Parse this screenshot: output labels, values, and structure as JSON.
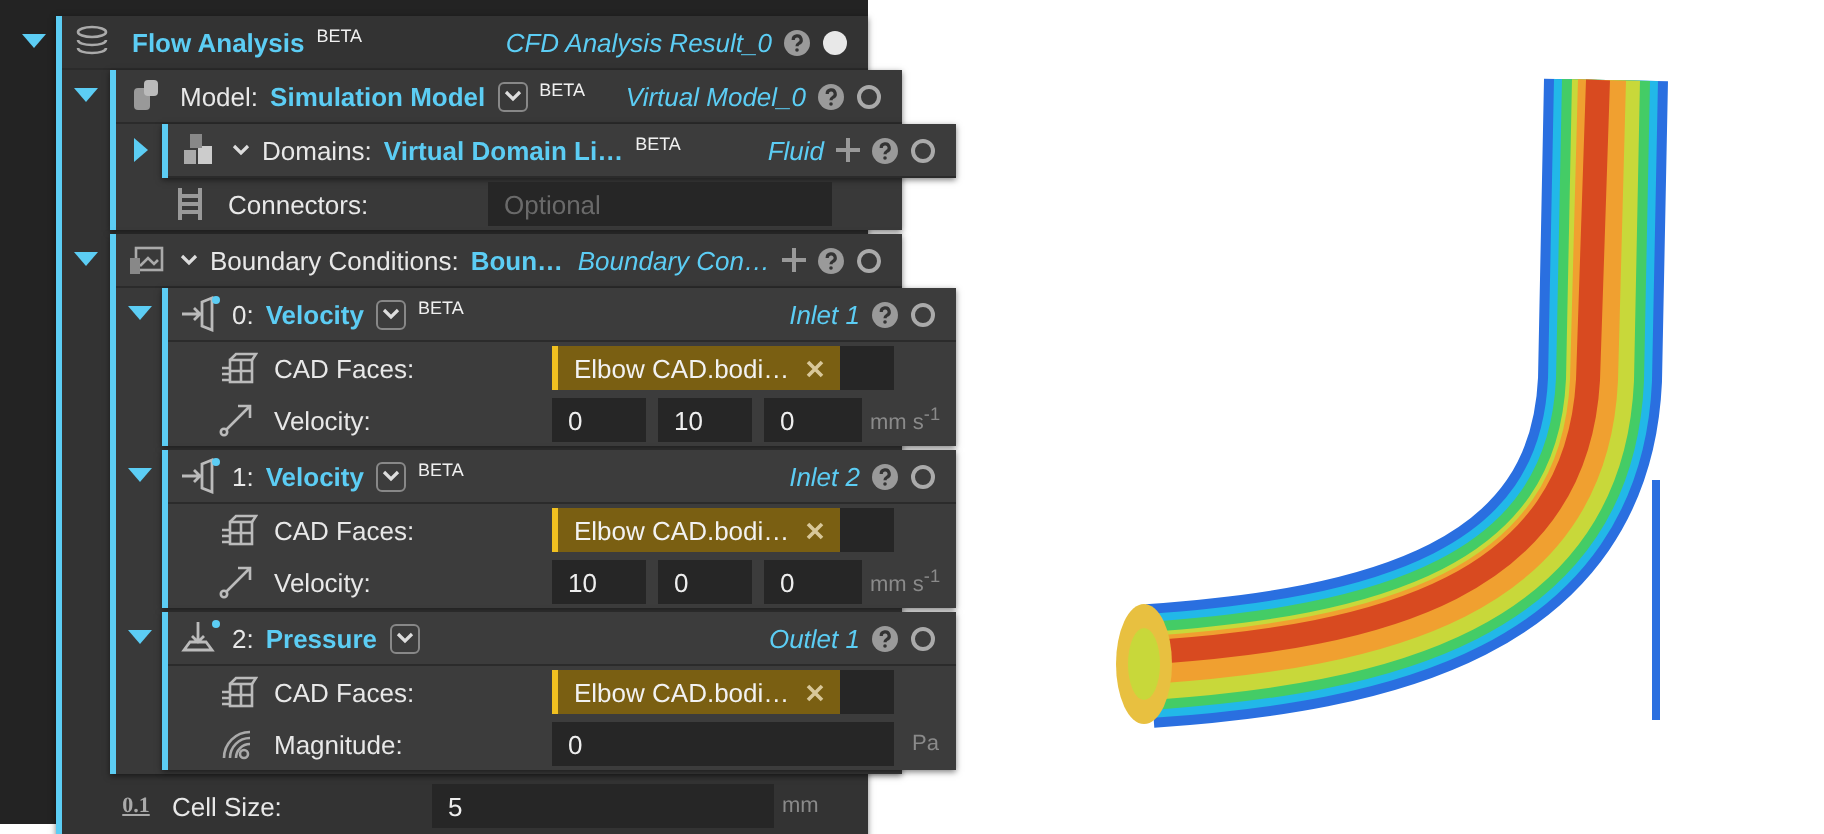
{
  "analysis": {
    "expanded": true,
    "title": "Flow Analysis",
    "badge": "BETA",
    "result": "CFD Analysis Result_0",
    "active": true,
    "model": {
      "expanded": true,
      "label": "Model:",
      "value": "Simulation Model",
      "dropdown": true,
      "badge": "BETA",
      "result": "Virtual Model_0",
      "active": false,
      "domains": {
        "expanded": false,
        "chevron": true,
        "label": "Domains:",
        "value": "Virtual Domain Li…",
        "badge": "BETA",
        "result": "Fluid",
        "add": true,
        "active": false
      },
      "connectors": {
        "label": "Connectors:",
        "placeholder": "Optional"
      }
    },
    "boundary_conditions": {
      "expanded": true,
      "chevron": true,
      "label": "Boundary Conditions:",
      "value": "Boun…",
      "result": "Boundary Con…",
      "add": true,
      "active": false,
      "conditions": [
        {
          "expanded": true,
          "kind": "inlet",
          "modified": true,
          "label": "0:",
          "value": "Velocity",
          "dropdown": true,
          "badge": "BETA",
          "result": "Inlet 1",
          "active": false,
          "fields": [
            {
              "kind": "faces",
              "label": "CAD Faces:",
              "value": "Elbow CAD.bodi…"
            },
            {
              "kind": "vector",
              "label": "Velocity:",
              "values": [
                "0",
                "10",
                "0"
              ],
              "unit": "mm s$^{-1}$"
            }
          ]
        },
        {
          "expanded": true,
          "kind": "inlet",
          "modified": true,
          "label": "1:",
          "value": "Velocity",
          "dropdown": true,
          "badge": "BETA",
          "result": "Inlet 2",
          "active": false,
          "fields": [
            {
              "kind": "faces",
              "label": "CAD Faces:",
              "value": "Elbow CAD.bodi…"
            },
            {
              "kind": "vector",
              "label": "Velocity:",
              "values": [
                "10",
                "0",
                "0"
              ],
              "unit": "mm s$^{-1}$"
            }
          ]
        },
        {
          "expanded": true,
          "kind": "outlet",
          "modified": true,
          "label": "2:",
          "value": "Pressure",
          "dropdown": true,
          "result": "Outlet 1",
          "active": false,
          "fields": [
            {
              "kind": "faces",
              "label": "CAD Faces:",
              "value": "Elbow CAD.bodi…"
            },
            {
              "kind": "scalar",
              "label": "Magnitude:",
              "value": "0",
              "unit": "Pa"
            }
          ]
        }
      ]
    },
    "cell_size": {
      "symbol": "0.1",
      "label": "Cell Size:",
      "value": "5",
      "unit": "mm"
    }
  }
}
